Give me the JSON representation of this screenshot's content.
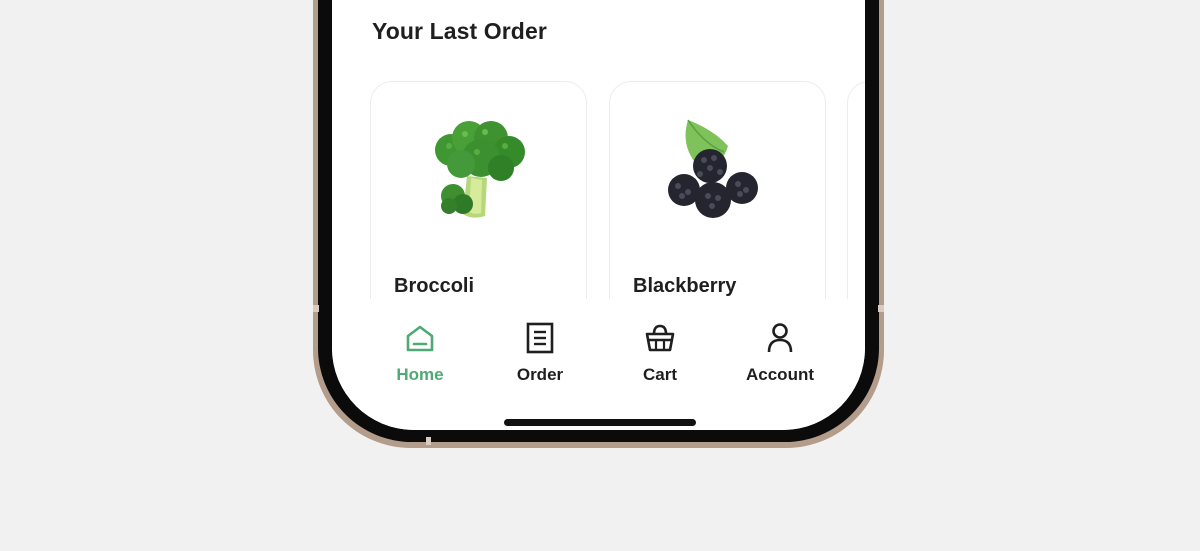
{
  "section": {
    "title": "Your Last Order"
  },
  "orders": [
    {
      "name": "Broccoli",
      "icon": "broccoli-image"
    },
    {
      "name": "Blackberry",
      "icon": "blackberry-image"
    }
  ],
  "nav": {
    "items": [
      {
        "label": "Home",
        "icon": "home-icon",
        "active": true
      },
      {
        "label": "Order",
        "icon": "order-list-icon",
        "active": false
      },
      {
        "label": "Cart",
        "icon": "basket-icon",
        "active": false
      },
      {
        "label": "Account",
        "icon": "user-icon",
        "active": false
      }
    ]
  },
  "colors": {
    "accent": "#4eaa72",
    "text": "#1f1f1f",
    "frame": "#b39c8a",
    "background": "#f1f1f1"
  }
}
